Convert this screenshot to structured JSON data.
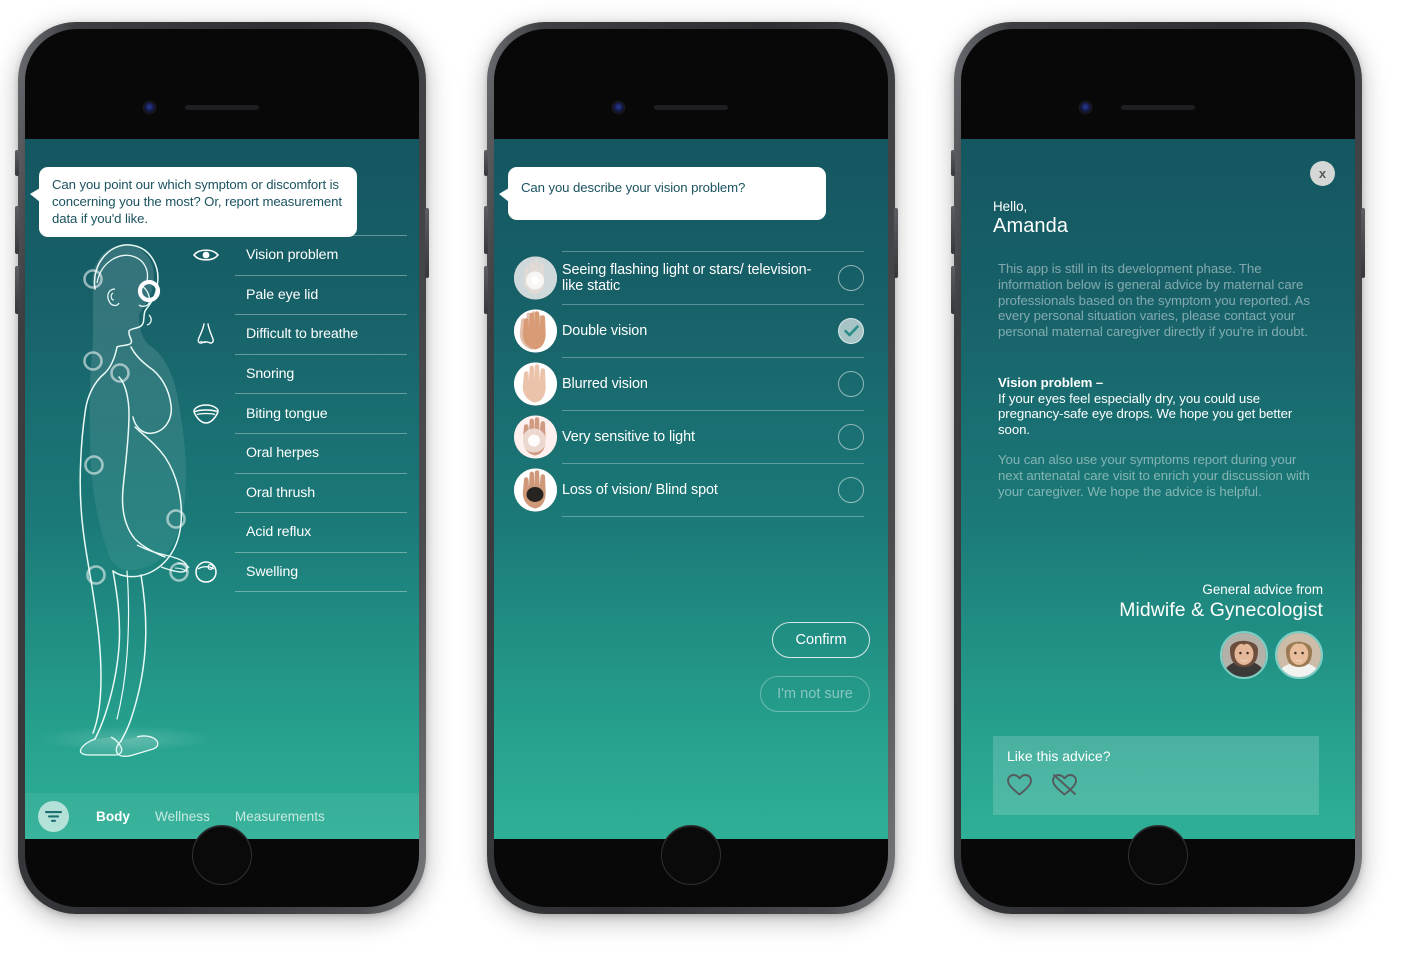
{
  "colors": {
    "screen_top": "#145761",
    "screen_bottom": "#2eb096",
    "bubble_text": "#1b5360",
    "accent_white": "#ffffff",
    "avatar_ring": "#7fcfc7",
    "close_bg": "#d5d6d6"
  },
  "phone1": {
    "bubble": "Can you point our which symptom or discomfort is concerning you the most? Or, report measurement data if you'd like.",
    "body_illustration": "pregnant-woman-side-view-line-art",
    "hotspots": [
      "eye",
      "back-of-head",
      "neck",
      "chest",
      "belly",
      "lower-back",
      "hip",
      "hand"
    ],
    "active_hotspot": "eye",
    "symptoms": [
      {
        "label": "Vision problem",
        "icon": "eye-icon"
      },
      {
        "label": "Pale eye lid",
        "icon": ""
      },
      {
        "label": "Difficult to breathe",
        "icon": "nose-icon"
      },
      {
        "label": "Snoring",
        "icon": ""
      },
      {
        "label": "Biting tongue",
        "icon": "mouth-icon"
      },
      {
        "label": "Oral herpes",
        "icon": ""
      },
      {
        "label": "Oral thrush",
        "icon": ""
      },
      {
        "label": "Acid reflux",
        "icon": ""
      },
      {
        "label": "Swelling",
        "icon": "swollen-face-icon"
      }
    ],
    "tabbar": {
      "filter_icon": "filter-icon",
      "tabs": [
        {
          "label": "Body",
          "active": true
        },
        {
          "label": "Wellness",
          "active": false
        },
        {
          "label": "Measurements",
          "active": false
        }
      ]
    }
  },
  "phone2": {
    "bubble": "Can you describe your vision problem?",
    "options": [
      {
        "label": "Seeing flashing light or stars/ television-like static",
        "thumb": "hand-flashing-light-thumb",
        "selected": false
      },
      {
        "label": "Double vision",
        "thumb": "hand-double-vision-thumb",
        "selected": true
      },
      {
        "label": "Blurred vision",
        "thumb": "hand-blurred-thumb",
        "selected": false
      },
      {
        "label": "Very sensitive to light",
        "thumb": "hand-light-sensitive-thumb",
        "selected": false
      },
      {
        "label": "Loss of vision/ Blind spot",
        "thumb": "hand-blind-spot-thumb",
        "selected": false
      }
    ],
    "confirm_label": "Confirm",
    "notsure_label": "I'm not sure"
  },
  "phone3": {
    "close_label": "x",
    "greeting": "Hello,",
    "user_name": "Amanda",
    "intro": "This app is still in its development phase. The information below is general advice by maternal care professionals based on the symptom you reported. As every personal situation varies, please contact your personal maternal caregiver directly if you're in doubt.",
    "advice_title": "Vision problem –",
    "advice_body": "If your eyes feel especially dry, you could use pregnancy-safe eye drops. We hope you get better soon.",
    "outro": "You can also use your symptoms report during your next antenatal care visit to enrich your discussion with your caregiver. We hope the advice is helpful.",
    "from_small": "General advice from",
    "from_big": "Midwife & Gynecologist",
    "avatars": [
      "midwife-portrait",
      "gynecologist-portrait"
    ],
    "feedback": {
      "title": "Like this advice?",
      "like_icon": "heart-icon",
      "dislike_icon": "heart-crossed-icon"
    }
  }
}
